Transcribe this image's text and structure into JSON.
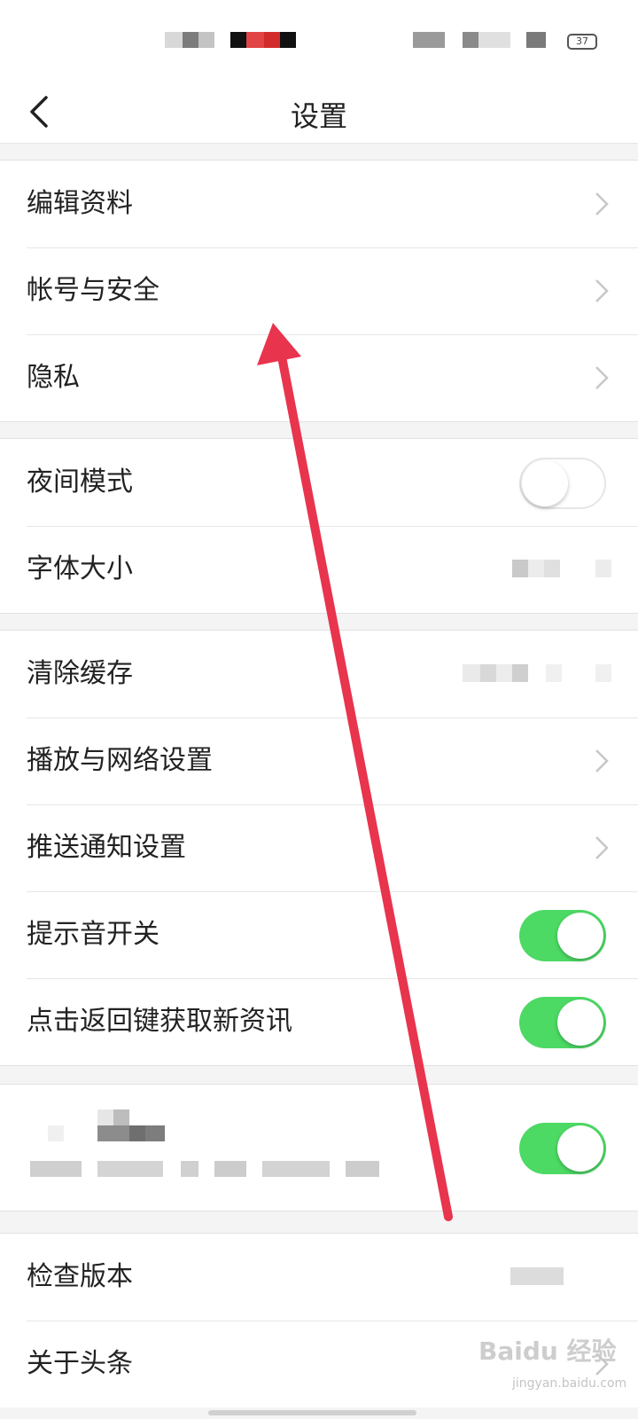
{
  "status_bar": {
    "battery": "37"
  },
  "nav": {
    "title": "设置"
  },
  "groups": [
    {
      "rows": [
        {
          "label": "编辑资料",
          "control": "chevron"
        },
        {
          "label": "帐号与安全",
          "control": "chevron"
        },
        {
          "label": "隐私",
          "control": "chevron"
        }
      ]
    },
    {
      "rows": [
        {
          "label": "夜间模式",
          "control": "toggle",
          "on": false
        },
        {
          "label": "字体大小",
          "control": "value"
        }
      ]
    },
    {
      "rows": [
        {
          "label": "清除缓存",
          "control": "value"
        },
        {
          "label": "播放与网络设置",
          "control": "chevron"
        },
        {
          "label": "推送通知设置",
          "control": "chevron"
        },
        {
          "label": "提示音开关",
          "control": "toggle",
          "on": true
        },
        {
          "label": "点击返回键获取新资讯",
          "control": "toggle",
          "on": true
        }
      ]
    },
    {
      "rows": [
        {
          "label": "",
          "control": "toggle",
          "on": true
        }
      ]
    },
    {
      "rows": [
        {
          "label": "检查版本",
          "control": "value"
        },
        {
          "label": "关于头条",
          "control": "chevron"
        }
      ]
    }
  ],
  "watermark": {
    "brand": "Baidu 经验",
    "site": "jingyan.baidu.com"
  },
  "colors": {
    "toggle_on": "#4cd964",
    "annotation_arrow": "#e8344d"
  }
}
